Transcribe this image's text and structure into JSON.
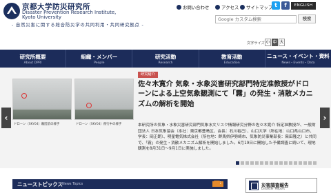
{
  "header": {
    "site_name_ja": "京都大学防災研究所",
    "site_name_en_line1": "Disaster Prevention Research Institute,",
    "site_name_en_line2": "Kyoto University",
    "tagline": "- 自然災害に関する総合防災学の共同利用・共同研究拠点 -"
  },
  "utility_links": [
    {
      "label": "お問い合わせ"
    },
    {
      "label": "アクセス"
    },
    {
      "label": "サイトマップ"
    }
  ],
  "social": {
    "twitter": "t",
    "facebook": "f"
  },
  "english_label": "ENGLISH",
  "search": {
    "placeholder": "Google カスタム検索",
    "button_label": "検索"
  },
  "font_size": {
    "label": "文字サイズ",
    "options": [
      "小",
      "中",
      "大"
    ],
    "selected": "中"
  },
  "nav": [
    {
      "ja": "研究所概要",
      "en": "About DPRI"
    },
    {
      "ja": "組織・メンバー",
      "en": "People"
    },
    {
      "ja": "研究活動",
      "en": "Research"
    },
    {
      "ja": "教育活動",
      "en": "Education"
    },
    {
      "ja": "ニュース・イベント・資料",
      "en": "News・Events・Data"
    }
  ],
  "slide": {
    "tag": "研究紹介",
    "title": "佐々木寛介 気象・水象災害研究部門特定准教授がドローンによる上空気象観測にて「霧」の発生・消散メカニズムの解析を開始",
    "body": "本研究所の気象・水象災害研究部門気象水文リスク情報研究分野の佐々木寛介 特定准教授が、一般財団法人 日本気象協会（本社：東京都豊島区、会長：石川裕己）、山口大学（所在地：山口県山口市、学長：岡正朗）、明星電気株式会社（所在地：群馬県伊勢崎市、気象防災事業部長：柴田隆之）と共同で、「霧」の発生・消散メカニズム解析を開始しました。6月19日に開始した予備調査に続いて、現地観測を8月31日〜9月1日に実施しました。",
    "photos": [
      {
        "caption": "ドローン（SKY04）離陸前の様子"
      },
      {
        "caption": "ドローン（SKY04）飛行中の様子"
      }
    ],
    "prev_arrow": "‹",
    "next_arrow": "›",
    "active_dot": 0
  },
  "topics": {
    "title_ja": "ニューストピックス",
    "title_en": "News Topics",
    "rss_label": "RSS"
  },
  "report": {
    "title": "災害調査報告",
    "subtitle": "Disaster Report"
  },
  "colors": {
    "navy": "#1c2c5a",
    "tag_red": "#c9524e",
    "rss_orange": "#e48a2b"
  }
}
